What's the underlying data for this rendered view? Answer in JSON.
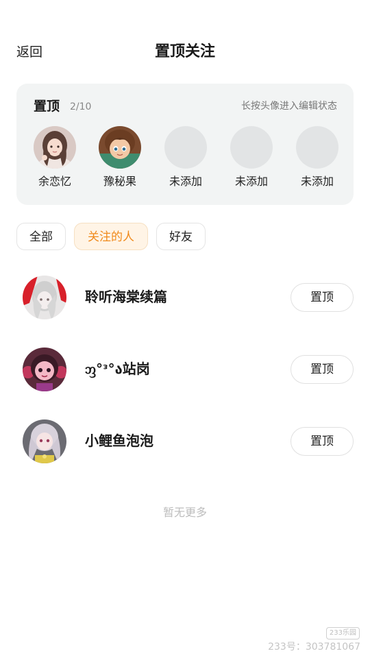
{
  "header": {
    "back_label": "返回",
    "title": "置顶关注"
  },
  "pin_card": {
    "title": "置顶",
    "count": "2/10",
    "hint": "长按头像进入编辑状态",
    "slots": [
      {
        "name": "余恋忆",
        "filled": true
      },
      {
        "name": "豫秘果",
        "filled": true
      },
      {
        "name": "未添加",
        "filled": false
      },
      {
        "name": "未添加",
        "filled": false
      },
      {
        "name": "未添加",
        "filled": false
      }
    ]
  },
  "filters": {
    "tabs": [
      {
        "label": "全部",
        "active": false
      },
      {
        "label": "关注的人",
        "active": true
      },
      {
        "label": "好友",
        "active": false
      }
    ],
    "accent_color": "#f08a1c"
  },
  "follow_list": {
    "items": [
      {
        "name": "聆听海棠续篇",
        "button": "置顶"
      },
      {
        "name": "ᦀ°ᵌ°ა站岗",
        "button": "置顶"
      },
      {
        "name": "小鲤鱼泡泡",
        "button": "置顶"
      }
    ],
    "empty_text": "暂无更多"
  },
  "watermark": {
    "logo": "233乐园",
    "id_text": "233号：303781067"
  }
}
